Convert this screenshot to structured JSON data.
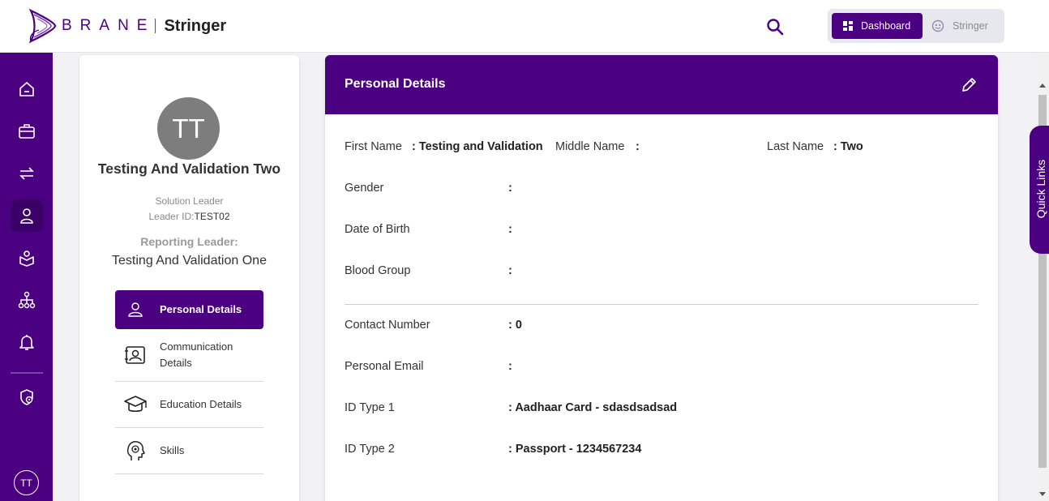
{
  "header": {
    "brand": "BRANE",
    "product": "Stringer",
    "toggle": {
      "dashboard_label": "Dashboard",
      "stringer_label": "Stringer"
    }
  },
  "sidebar": {
    "items": [
      {
        "icon": "home-icon"
      },
      {
        "icon": "briefcase-icon"
      },
      {
        "icon": "transfer-arrows-icon"
      },
      {
        "icon": "user-icon",
        "active": true
      },
      {
        "icon": "learning-icon"
      },
      {
        "icon": "hierarchy-icon"
      },
      {
        "icon": "bell-icon"
      },
      {
        "icon": "settings-shield-icon"
      }
    ],
    "avatar_initials": "TT"
  },
  "profile": {
    "initials": "TT",
    "name": "Testing And Validation Two",
    "role": "Solution Leader",
    "leader_id_label": "Leader ID:",
    "leader_id": "TEST02",
    "reporting_label": "Reporting Leader:",
    "reporting_name": "Testing And Validation One",
    "menu": [
      {
        "label": "Personal Details",
        "icon": "person-icon",
        "active": true
      },
      {
        "label": "Communication Details",
        "icon": "contact-card-icon"
      },
      {
        "label": "Education Details",
        "icon": "graduation-cap-icon"
      },
      {
        "label": "Skills",
        "icon": "brain-icon"
      }
    ]
  },
  "details": {
    "title": "Personal Details",
    "first_name_label": "First Name",
    "first_name_value": ": Testing and Validation",
    "middle_name_label": "Middle Name",
    "middle_name_value": ":",
    "last_name_label": "Last Name",
    "last_name_value": ": Two",
    "gender_label": "Gender",
    "gender_value": ":",
    "dob_label": "Date of Birth",
    "dob_value": ":",
    "blood_label": "Blood Group",
    "blood_value": ":",
    "contact_label": "Contact Number",
    "contact_value": ": 0",
    "email_label": "Personal Email",
    "email_value": ":",
    "id1_label": "ID Type 1",
    "id1_value": ": Aadhaar Card - sdasdsadsad",
    "id2_label": "ID Type 2",
    "id2_value": ": Passport - 1234567234"
  },
  "quick_links": "Quick Links",
  "colors": {
    "brand": "#4a0080",
    "brand_dark": "#3a0068"
  }
}
